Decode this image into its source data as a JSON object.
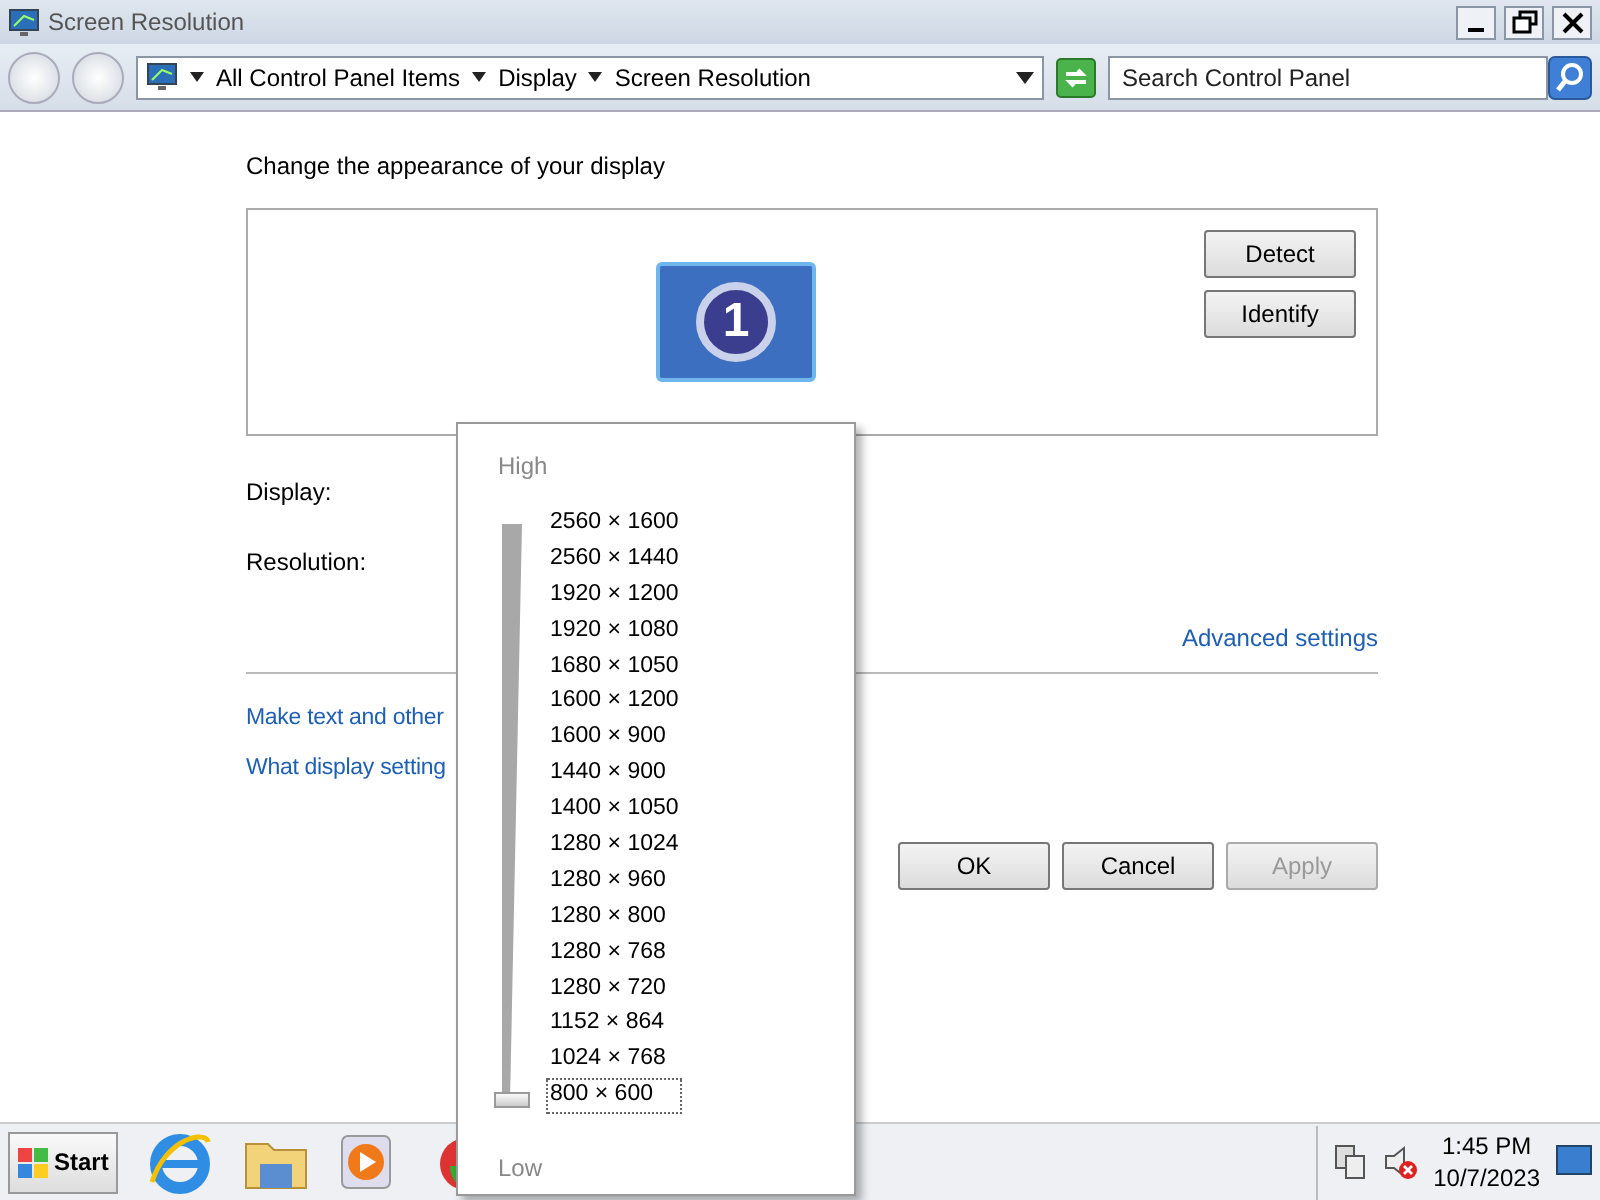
{
  "window": {
    "title": "Screen Resolution"
  },
  "address_bar": {
    "breadcrumbs": [
      "All Control Panel Items",
      "Display",
      "Screen Resolution"
    ]
  },
  "search": {
    "placeholder": "Search Control Panel"
  },
  "heading": "Change the appearance of your display",
  "monitor": {
    "number": "1"
  },
  "side_buttons": [
    "Detect",
    "Identify"
  ],
  "fields": [
    {
      "label": "Display:"
    },
    {
      "label": "Resolution:"
    }
  ],
  "advanced_link": "Advanced settings",
  "links": [
    "Make text and other",
    "What display setting"
  ],
  "dialog_buttons": [
    {
      "label": "OK",
      "disabled": false
    },
    {
      "label": "Cancel",
      "disabled": false
    },
    {
      "label": "Apply",
      "disabled": true
    }
  ],
  "resolution_popup": {
    "high_label": "High",
    "low_label": "Low",
    "level": 0,
    "options": [
      {
        "label": "2560 × 1600",
        "selected": false
      },
      {
        "label": "2560 × 1440",
        "selected": false
      },
      {
        "label": "1920 × 1200",
        "selected": false
      },
      {
        "label": "1920 × 1080",
        "selected": false
      },
      {
        "label": "1680 × 1050",
        "selected": false
      },
      {
        "label": "1600 × 1200",
        "selected": false
      },
      {
        "label": "1600 × 900",
        "selected": false
      },
      {
        "label": "1440 × 900",
        "selected": false
      },
      {
        "label": "1400 × 1050",
        "selected": false
      },
      {
        "label": "1280 × 1024",
        "selected": false
      },
      {
        "label": "1280 × 960",
        "selected": false
      },
      {
        "label": "1280 × 800",
        "selected": false
      },
      {
        "label": "1280 × 768",
        "selected": false
      },
      {
        "label": "1280 × 720",
        "selected": false
      },
      {
        "label": "1152 × 864",
        "selected": false
      },
      {
        "label": "1024 × 768",
        "selected": false
      },
      {
        "label": "800 × 600",
        "selected": true
      }
    ]
  },
  "taskbar": {
    "start_label": "Start",
    "time": "1:45 PM",
    "date": "10/7/2023"
  }
}
